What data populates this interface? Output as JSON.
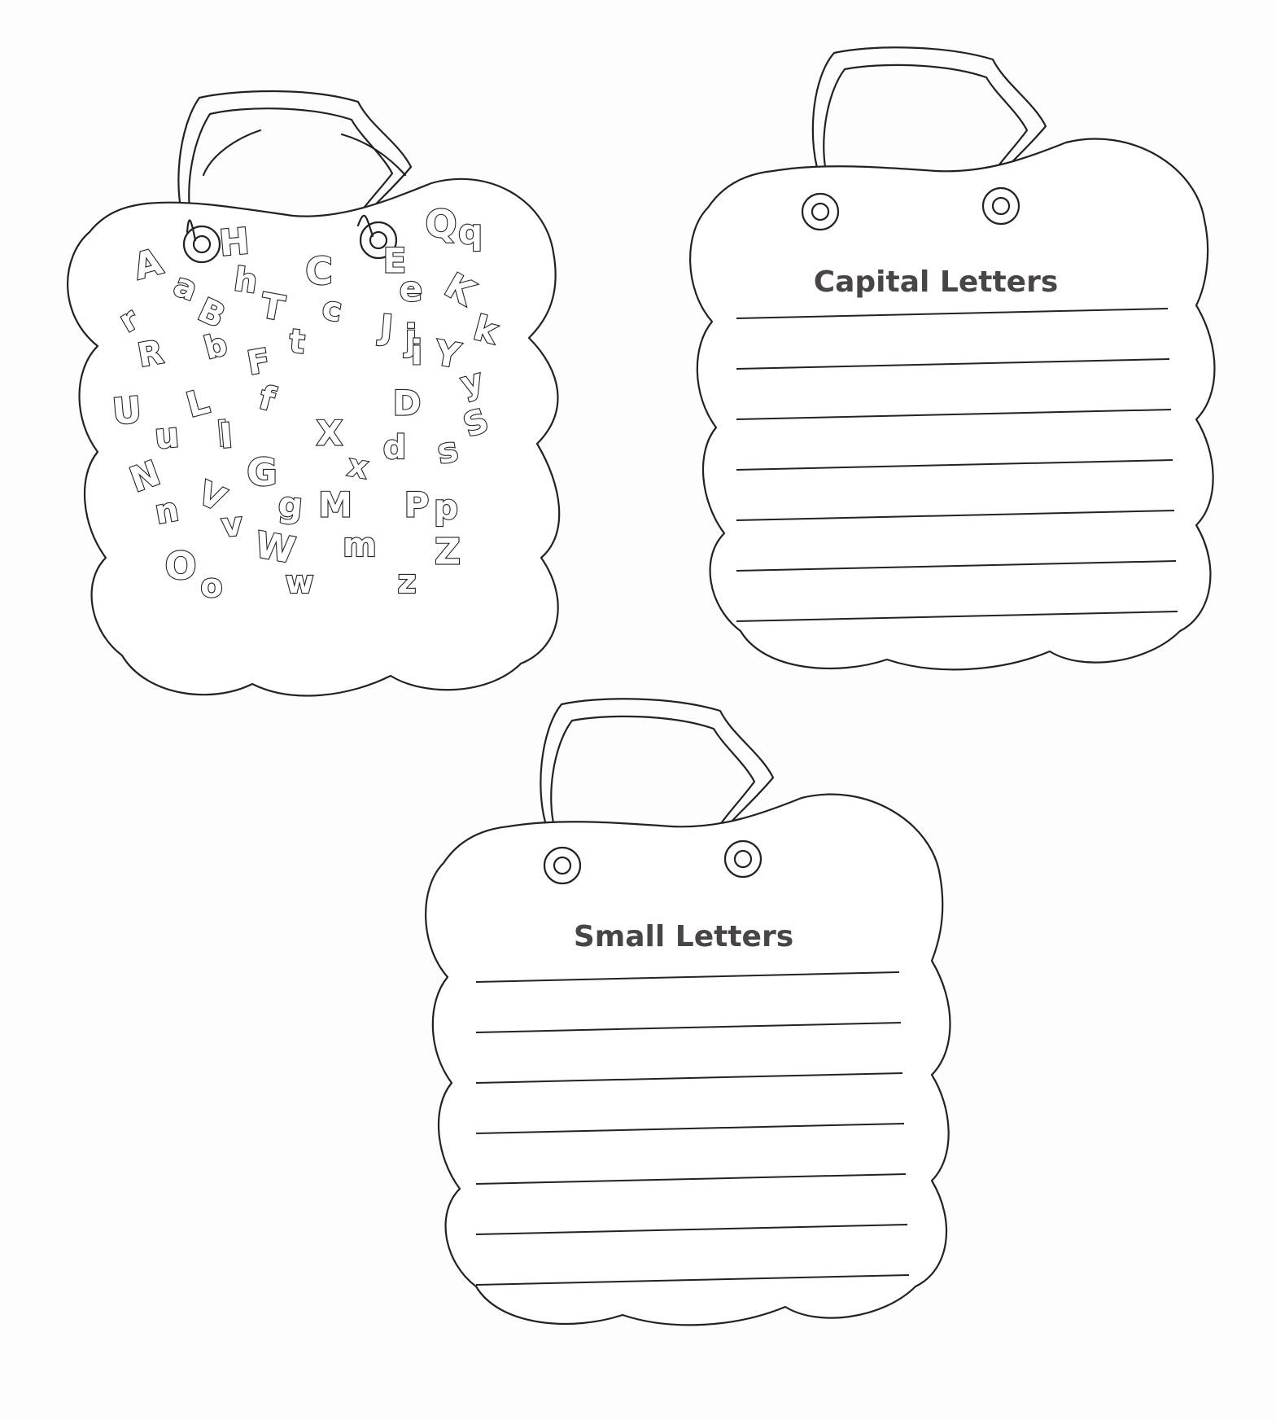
{
  "panels": {
    "alphabet": {
      "letters": [
        "A",
        "a",
        "H",
        "h",
        "B",
        "r",
        "R",
        "b",
        "T",
        "t",
        "C",
        "c",
        "F",
        "f",
        "E",
        "e",
        "J",
        "j",
        "i",
        "Q",
        "q",
        "K",
        "k",
        "Y",
        "y",
        "U",
        "u",
        "L",
        "l",
        "I",
        "D",
        "S",
        "s",
        "X",
        "x",
        "d",
        "N",
        "n",
        "G",
        "g",
        "M",
        "m",
        "V",
        "v",
        "W",
        "w",
        "O",
        "o",
        "P",
        "p",
        "Z",
        "z"
      ]
    },
    "capital": {
      "title": "Capital Letters",
      "line_count": 7
    },
    "small": {
      "title": "Small Letters",
      "line_count": 7
    }
  }
}
